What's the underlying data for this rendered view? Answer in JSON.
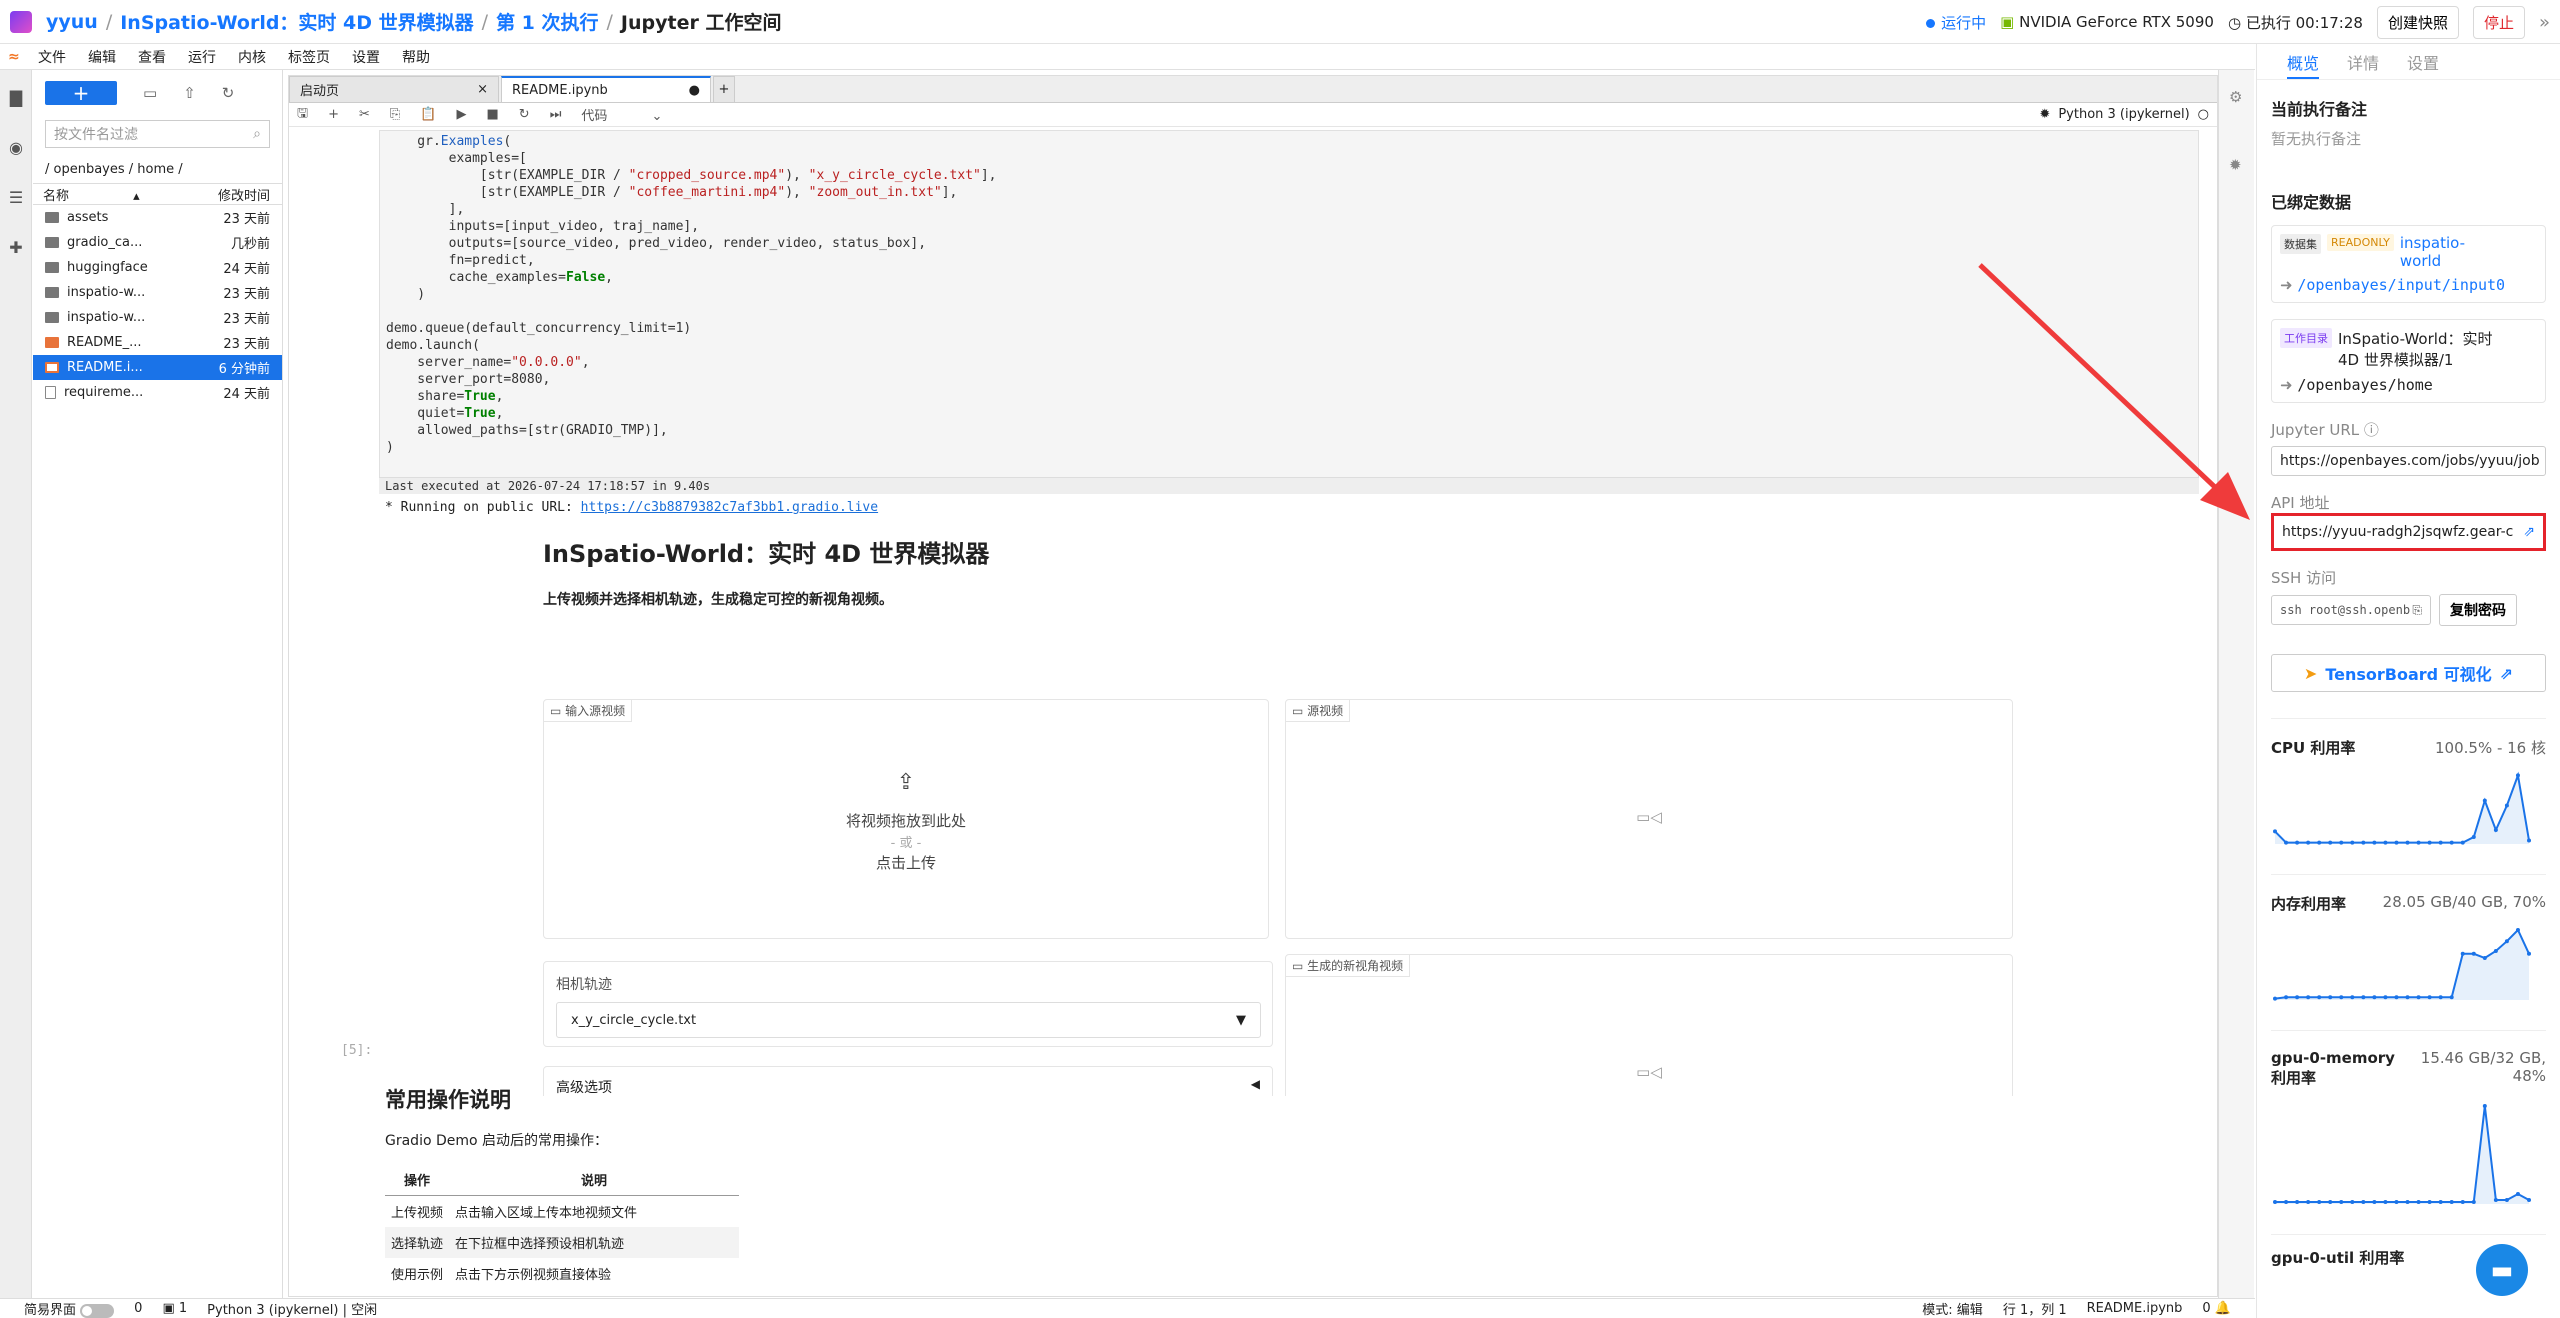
{
  "topbar": {
    "user": "yyuu",
    "project": "InSpatio-World：实时 4D 世界模拟器",
    "run": "第 1 次执行",
    "workspace": "Jupyter 工作空间",
    "status": "运行中",
    "gpu": "NVIDIA GeForce RTX 5090",
    "elapsed": "已执行 00:17:28",
    "snapshot_btn": "创建快照",
    "stop_btn": "停止"
  },
  "menu": [
    "文件",
    "编辑",
    "查看",
    "运行",
    "内核",
    "标签页",
    "设置",
    "帮助"
  ],
  "filebrowser": {
    "filter_placeholder": "按文件名过滤",
    "path": "/ openbayes / home /",
    "col_name": "名称",
    "col_modified": "修改时间",
    "files": [
      {
        "name": "assets",
        "modified": "23 天前",
        "type": "folder"
      },
      {
        "name": "gradio_ca...",
        "modified": "几秒前",
        "type": "folder"
      },
      {
        "name": "huggingface",
        "modified": "24 天前",
        "type": "folder"
      },
      {
        "name": "inspatio-w...",
        "modified": "23 天前",
        "type": "folder"
      },
      {
        "name": "inspatio-w...",
        "modified": "23 天前",
        "type": "folder"
      },
      {
        "name": "README_...",
        "modified": "23 天前",
        "type": "md"
      },
      {
        "name": "README.i...",
        "modified": "6 分钟前",
        "type": "nb"
      },
      {
        "name": "requireme...",
        "modified": "24 天前",
        "type": "txt"
      }
    ]
  },
  "tabs": {
    "launcher": "启动页",
    "notebook": "README.ipynb"
  },
  "nbtoolbar": {
    "celltype": "代码",
    "kernel": "Python 3 (ipykernel)"
  },
  "code": {
    "exec_note": "Last executed at 2026-07-24 17:18:57 in 9.40s",
    "running_prefix": "* Running on public URL: ",
    "running_url": "https://c3b8879382c7af3bb1.gradio.live"
  },
  "gradio": {
    "title": "InSpatio-World：实时 4D 世界模拟器",
    "subtitle": "上传视频并选择相机轨迹，生成稳定可控的新视角视频。",
    "input_label": "输入源视频",
    "drop_text": "将视频拖放到此处",
    "or_text": "- 或 -",
    "click_text": "点击上传",
    "source_label": "源视频",
    "traj_label": "相机轨迹",
    "traj_value": "x_y_circle_cycle.txt",
    "gen_label": "生成的新视角视频",
    "adv_label": "高级选项"
  },
  "cell5": {
    "prompt": "[5]:"
  },
  "markdown": {
    "title": "常用操作说明",
    "intro": "Gradio Demo 启动后的常用操作：",
    "th_op": "操作",
    "th_desc": "说明",
    "rows": [
      {
        "op": "上传视频",
        "desc": "点击输入区域上传本地视频文件"
      },
      {
        "op": "选择轨迹",
        "desc": "在下拉框中选择预设相机轨迹"
      },
      {
        "op": "使用示例",
        "desc": "点击下方示例视频直接体验"
      }
    ]
  },
  "rpanel": {
    "tab_overview": "概览",
    "tab_detail": "详情",
    "tab_settings": "设置",
    "note_title": "当前执行备注",
    "note_empty": "暂无执行备注",
    "bound_title": "已绑定数据",
    "dataset_tag": "数据集",
    "readonly_tag": "READONLY",
    "dataset_name": "inspatio-world",
    "dataset_path": "/openbayes/input/input0",
    "workdir_tag": "工作目录",
    "workdir_name": "InSpatio-World：实时 4D 世界模拟器/1",
    "workdir_path": "/openbayes/home",
    "jupyter_label": "Jupyter URL",
    "jupyter_url": "https://openbayes.com/jobs/yyuu/job",
    "api_label": "API 地址",
    "api_url": "https://yyuu-radgh2jsqwfz.gear-c",
    "ssh_label": "SSH 访问",
    "ssh_cmd": "ssh root@ssh.openbayes",
    "copy_pwd": "复制密码",
    "tensorboard": "TensorBoard 可视化",
    "metrics": [
      {
        "name": "CPU 利用率",
        "value": "100.5% - 16 核",
        "series": [
          0.18,
          0.02,
          0.02,
          0.02,
          0.02,
          0.02,
          0.02,
          0.02,
          0.02,
          0.02,
          0.02,
          0.02,
          0.02,
          0.02,
          0.02,
          0.02,
          0.02,
          0.02,
          0.1,
          0.62,
          0.2,
          0.55,
          0.98,
          0.05
        ]
      },
      {
        "name": "内存利用率",
        "value": "28.05 GB/40 GB, 70%",
        "series": [
          0.02,
          0.04,
          0.04,
          0.04,
          0.04,
          0.04,
          0.04,
          0.04,
          0.04,
          0.04,
          0.04,
          0.04,
          0.04,
          0.04,
          0.04,
          0.04,
          0.04,
          0.66,
          0.66,
          0.6,
          0.7,
          0.84,
          1.0,
          0.66
        ]
      },
      {
        "name": "gpu-0-memory 利用率",
        "value": "15.46 GB/32 GB, 48%",
        "series": [
          0.02,
          0.02,
          0.02,
          0.02,
          0.02,
          0.02,
          0.02,
          0.02,
          0.02,
          0.02,
          0.02,
          0.02,
          0.02,
          0.02,
          0.02,
          0.02,
          0.02,
          0.02,
          0.02,
          0.98,
          0.04,
          0.04,
          0.1,
          0.04
        ]
      },
      {
        "name": "gpu-0-util 利用率",
        "value": "",
        "series": []
      }
    ]
  },
  "statusbar": {
    "simple": "简易界面",
    "kernel_count": "0",
    "term_count": "1",
    "kernel_status": "Python 3 (ipykernel) | 空闲",
    "mode": "模式: 编辑",
    "cursor": "行 1，列 1",
    "file": "README.ipynb",
    "notif": "0"
  }
}
